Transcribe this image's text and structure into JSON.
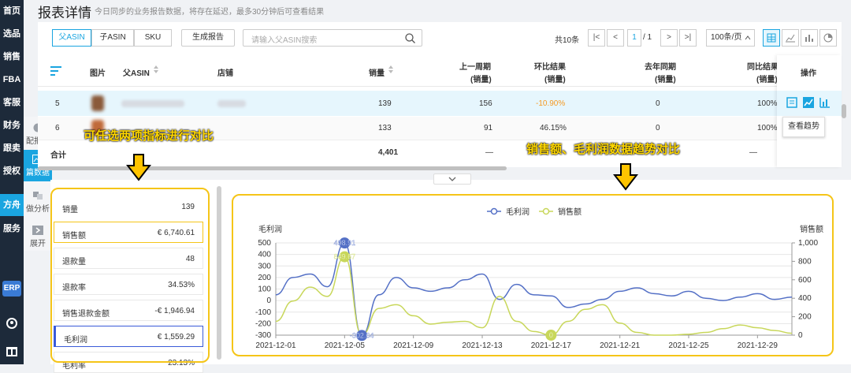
{
  "nav": {
    "items": [
      {
        "label": "首页"
      },
      {
        "label": "选品"
      },
      {
        "label": "销售"
      },
      {
        "label": "FBA"
      },
      {
        "label": "客服"
      },
      {
        "label": "财务"
      },
      {
        "label": "跟卖"
      },
      {
        "label": "授权"
      },
      {
        "label": "方舟"
      },
      {
        "label": "服务"
      }
    ],
    "erp": "ERP"
  },
  "subnav": {
    "items": [
      {
        "label": "配报表"
      },
      {
        "label": "篇数据"
      },
      {
        "label": "做分析"
      },
      {
        "label": "展开"
      }
    ]
  },
  "header": {
    "title": "报表详情",
    "subtitle": "今日同步的业务报告数据，将存在延迟，最多30分钟后可查看结果"
  },
  "toolbar": {
    "segments": [
      "父ASIN",
      "子ASIN",
      "SKU"
    ],
    "generate": "生成报告",
    "search_placeholder": "请输入父ASIN搜索",
    "total": "共10条",
    "page_current": "1",
    "page_total": "/ 1",
    "page_size": "100条/页"
  },
  "table": {
    "headers": {
      "image": "图片",
      "asin": "父ASIN",
      "store": "店铺",
      "sales": "销量",
      "prev_week": "上一周期",
      "prev_week_sub": "(销量)",
      "wow": "环比结果",
      "wow_sub": "(销量)",
      "last_year": "去年同期",
      "last_year_sub": "(销量)",
      "yoy": "同比结果",
      "yoy_sub": "(销量)",
      "action": "操作"
    },
    "rows": [
      {
        "idx": "5",
        "sales": "139",
        "prev": "156",
        "wow": "-10.90%",
        "ly": "0",
        "yoy": "100%"
      },
      {
        "idx": "6",
        "sales": "133",
        "prev": "91",
        "wow": "46.15%",
        "ly": "0",
        "yoy": "100%"
      }
    ],
    "total": {
      "label": "合计",
      "sales": "4,401",
      "prev": "—",
      "ly": "—"
    },
    "tooltip": "查看趋势"
  },
  "metrics": [
    {
      "label": "销量",
      "value": "139"
    },
    {
      "label": "销售额",
      "value": "€ 6,740.61"
    },
    {
      "label": "退款量",
      "value": "48"
    },
    {
      "label": "退款率",
      "value": "34.53%"
    },
    {
      "label": "销售退款金额",
      "value": "-€ 1,946.94"
    },
    {
      "label": "毛利润",
      "value": "€ 1,559.29"
    },
    {
      "label": "毛利率",
      "value": "23.13%"
    }
  ],
  "annotations": {
    "left": "可任选两项指标进行对比",
    "right": "销售额、毛利润数据趋势对比"
  },
  "colors": {
    "accent": "#1aa5e0",
    "highlight": "#f5c518",
    "profit": "#5470c6",
    "sales": "#c8d75a"
  },
  "chart_data": {
    "type": "line",
    "title": "",
    "ylabel_left": "毛利润",
    "ylabel_right": "销售额",
    "legend": [
      "毛利润",
      "销售额"
    ],
    "legend_position": "top-center",
    "x": [
      "2021-12-01",
      "2021-12-02",
      "2021-12-03",
      "2021-12-04",
      "2021-12-05",
      "2021-12-06",
      "2021-12-07",
      "2021-12-08",
      "2021-12-09",
      "2021-12-10",
      "2021-12-11",
      "2021-12-12",
      "2021-12-13",
      "2021-12-14",
      "2021-12-15",
      "2021-12-16",
      "2021-12-17",
      "2021-12-18",
      "2021-12-19",
      "2021-12-20",
      "2021-12-21",
      "2021-12-22",
      "2021-12-23",
      "2021-12-24",
      "2021-12-25",
      "2021-12-26",
      "2021-12-27",
      "2021-12-28",
      "2021-12-29",
      "2021-12-30",
      "2021-12-31"
    ],
    "x_tick_labels": [
      "2021-12-01",
      "2021-12-05",
      "2021-12-09",
      "2021-12-13",
      "2021-12-17",
      "2021-12-21",
      "2021-12-25",
      "2021-12-29"
    ],
    "ylim_left": [
      -300,
      500
    ],
    "yticks_left": [
      500,
      400,
      300,
      200,
      100,
      0,
      -100,
      -200,
      -300
    ],
    "ylim_right": [
      0,
      1000
    ],
    "yticks_right": [
      1000,
      800,
      600,
      400,
      200,
      0
    ],
    "grid": true,
    "series": [
      {
        "name": "毛利润",
        "axis": "left",
        "values": [
          50,
          200,
          230,
          120,
          498.91,
          -302.64,
          50,
          200,
          110,
          80,
          110,
          180,
          230,
          10,
          140,
          50,
          40,
          -60,
          -30,
          10,
          80,
          110,
          60,
          40,
          80,
          20,
          0,
          30,
          60,
          10,
          30
        ],
        "labels": [
          {
            "index": 4,
            "text": "498.91"
          },
          {
            "index": 5,
            "text": "-302.64"
          }
        ]
      },
      {
        "name": "销售额",
        "axis": "right",
        "values": [
          150,
          370,
          520,
          420,
          849.67,
          0,
          290,
          330,
          210,
          120,
          140,
          150,
          80,
          420,
          150,
          40,
          0,
          150,
          280,
          330,
          130,
          30,
          0,
          0,
          10,
          30,
          70,
          110,
          80,
          50,
          20
        ],
        "labels": [
          {
            "index": 4,
            "text": "849.67"
          },
          {
            "index": 16,
            "text": "0"
          }
        ]
      }
    ]
  }
}
